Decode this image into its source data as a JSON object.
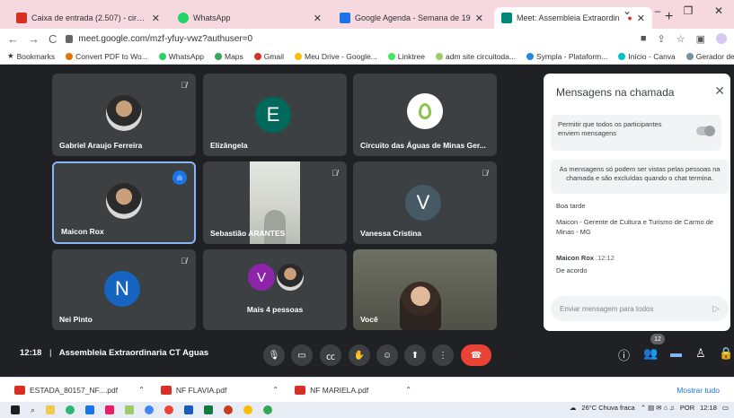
{
  "browser": {
    "tabs": [
      {
        "title": "Caixa de entrada (2.507) - circuit",
        "active": false,
        "favicon_color": "#d93025"
      },
      {
        "title": "WhatsApp",
        "active": false,
        "favicon_color": "#25d366"
      },
      {
        "title": "Google Agenda - Semana de 19",
        "active": false,
        "favicon_color": "#1a73e8"
      },
      {
        "title": "Meet: Assembleia Extraordin",
        "active": true,
        "favicon_color": "#00897b"
      }
    ],
    "url": "meet.google.com/mzf-yfuy-vwz?authuser=0",
    "bookmarks": [
      "Bookmarks",
      "Convert PDF to Wo...",
      "WhatsApp",
      "Maps",
      "Gmail",
      "Meu Drive - Google...",
      "Linktree",
      "adm site circuitoda...",
      "Sympla - Plataform...",
      "Início - Canva",
      "Gerador de nuvem..."
    ]
  },
  "participants": {
    "gabriel": "Gabriel Araujo Ferreira",
    "elizangela": "Elizângela",
    "elizangela_initial": "E",
    "circuito": "Circuito das Águas de Minas Ger...",
    "maicon": "Maicon Rox",
    "sebastiao": "Sebastião ARANTES",
    "vanessa": "Vanessa Cristina",
    "vanessa_initial": "V",
    "nei": "Nei Pinto",
    "nei_initial": "N",
    "more": "Mais 4 pessoas",
    "more_initial": "V",
    "you": "Você"
  },
  "chat": {
    "title": "Mensagens na chamada",
    "permission": "Permitir que todos os participantes enviem mensagens",
    "notice": "As mensagens só podem ser vistas pelas pessoas na chamada e são excluídas quando o chat termina.",
    "msg1_line1": "Boa tarde",
    "msg1_line2": "Maicon - Gerente de Cultura e Turismo de Carmo de Minas - MG",
    "msg2_sender": "Maicon Rox",
    "msg2_time": "12:12",
    "msg2_text": "De acordo",
    "input_placeholder": "Enviar mensagem para todos"
  },
  "meeting": {
    "time": "12:18",
    "separator": "|",
    "name": "Assembleia Extraordinaria CT Aguas",
    "participant_count": "12"
  },
  "downloads": {
    "files": [
      "ESTADA_80157_NF....pdf",
      "NF FLAVIA.pdf",
      "NF MARIELA.pdf"
    ],
    "show_all": "Mostrar tudo"
  },
  "taskbar": {
    "weather": "26°C  Chuva fraca",
    "lang": "POR",
    "clock": "12:18"
  },
  "colors": {
    "meet_bg": "#202124",
    "tile_bg": "#3c4043",
    "accent": "#8ab4f8",
    "end_call": "#ea4335",
    "elizangela_avatar": "#00695c",
    "vanessa_avatar": "#455a64",
    "nei_avatar": "#1565c0",
    "more_avatar": "#8e24aa"
  }
}
